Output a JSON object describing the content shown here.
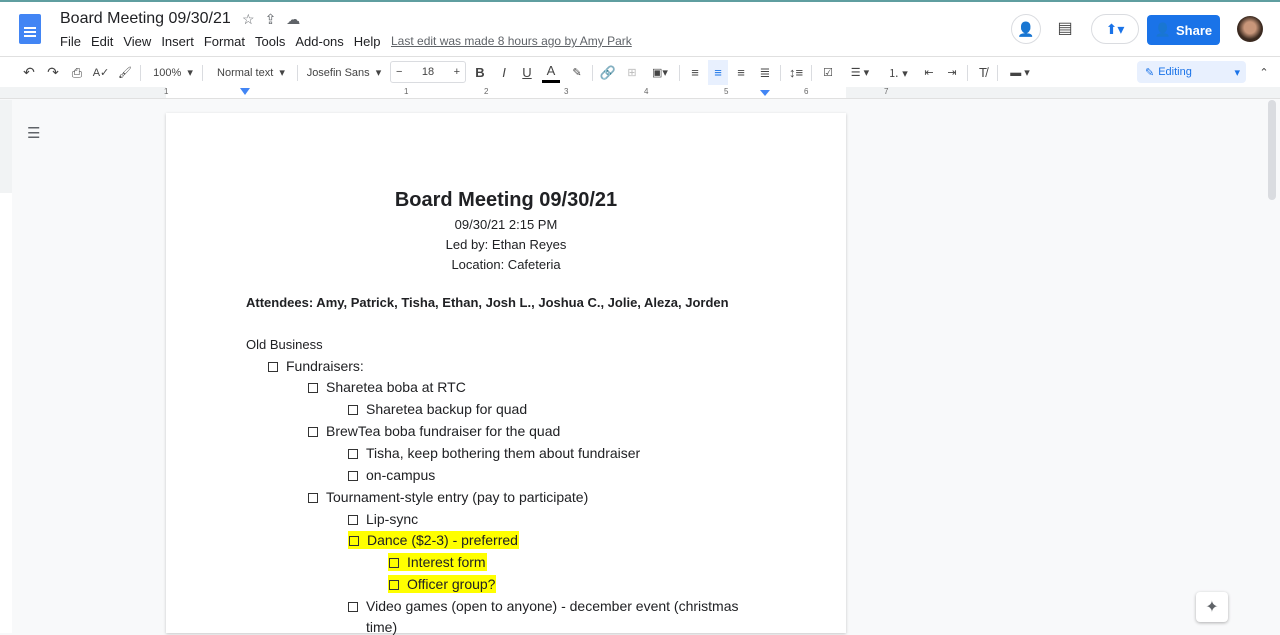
{
  "header": {
    "title": "Board Meeting 09/30/21",
    "menu": [
      "File",
      "Edit",
      "View",
      "Insert",
      "Format",
      "Tools",
      "Add-ons",
      "Help"
    ],
    "last_edit": "Last edit was made 8 hours ago by Amy Park",
    "share_label": "Share"
  },
  "toolbar": {
    "zoom": "100%",
    "style": "Normal text",
    "font": "Josefin Sans",
    "font_size": "18",
    "mode": "Editing"
  },
  "ruler": {
    "marks": [
      "1",
      "1",
      "2",
      "3",
      "4",
      "5",
      "6",
      "7"
    ]
  },
  "doc": {
    "title": "Board Meeting 09/30/21",
    "datetime": "09/30/21  2:15 PM",
    "led_by": "Led by: Ethan Reyes",
    "location": "Location: Cafeteria",
    "attendees": "Attendees: Amy, Patrick, Tisha, Ethan, Josh L., Joshua C., Jolie, Aleza, Jorden",
    "section": "Old Business",
    "items": [
      {
        "text": "Fundraisers:",
        "level": 1,
        "hl": false
      },
      {
        "text": "Sharetea boba at RTC",
        "level": 2,
        "hl": false
      },
      {
        "text": "Sharetea backup for quad",
        "level": 3,
        "hl": false
      },
      {
        "text": "BrewTea boba fundraiser for the quad",
        "level": 2,
        "hl": false
      },
      {
        "text": "Tisha, keep bothering them about fundraiser",
        "level": 3,
        "hl": false
      },
      {
        "text": "on-campus",
        "level": 3,
        "hl": false
      },
      {
        "text": "Tournament-style entry (pay to participate)",
        "level": 2,
        "hl": false
      },
      {
        "text": "Lip-sync",
        "level": 3,
        "hl": false
      },
      {
        "text": "Dance ($2-3) - preferred",
        "level": 3,
        "hl": true
      },
      {
        "text": "Interest form",
        "level": 4,
        "hl": true
      },
      {
        "text": "Officer group?",
        "level": 4,
        "hl": true
      },
      {
        "text": "Video games (open to anyone) - december event (christmas",
        "level": 3,
        "hl": false
      },
      {
        "text": "time)",
        "level": 3,
        "hl": false,
        "cont": true
      }
    ]
  },
  "colors": {
    "accent": "#1a73e8",
    "highlight": "#ffff00"
  }
}
